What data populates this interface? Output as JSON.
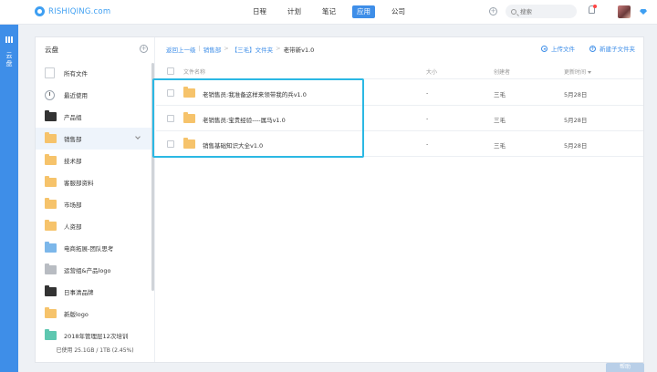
{
  "brand": {
    "name": "RISHIQING.com"
  },
  "nav": {
    "items": [
      "日程",
      "计划",
      "笔记",
      "应用",
      "公司"
    ],
    "active": "应用"
  },
  "header": {
    "search_placeholder": "搜索"
  },
  "leftbar": {
    "label": "云盘"
  },
  "sidebar": {
    "title": "云盘",
    "items": [
      {
        "label": "所有文件",
        "icon": "file-icon"
      },
      {
        "label": "最近使用",
        "icon": "clock-icon"
      },
      {
        "label": "产品组",
        "icon": "folder-icon"
      },
      {
        "label": "销售部",
        "icon": "folder-icon"
      },
      {
        "label": "技术部",
        "icon": "folder-icon"
      },
      {
        "label": "客服部资料",
        "icon": "folder-icon"
      },
      {
        "label": "市场部",
        "icon": "folder-icon"
      },
      {
        "label": "人资部",
        "icon": "folder-icon"
      },
      {
        "label": "电商拓展-团队思考",
        "icon": "folder-icon"
      },
      {
        "label": "运营组&产品logo",
        "icon": "folder-icon"
      },
      {
        "label": "日事清品牌",
        "icon": "folder-icon"
      },
      {
        "label": "新版logo",
        "icon": "folder-icon"
      },
      {
        "label": "2018年管理层12次培训",
        "icon": "folder-icon"
      }
    ],
    "usage": "已使用 25.1GB / 1TB (2.45%)"
  },
  "breadcrumb": {
    "back": "返回上一级",
    "items": [
      "销售部",
      "【三毛】文件夹",
      "老带新v1.0"
    ]
  },
  "toolbar": {
    "upload": "上传文件",
    "new_folder": "新建子文件夹"
  },
  "table": {
    "columns": {
      "name": "文件名称",
      "size": "大小",
      "creator": "创建者",
      "updated": "更新时间"
    },
    "rows": [
      {
        "name": "老销售员:我准备这样来领带我的兵v1.0",
        "size": "-",
        "creator": "三毛",
        "updated": "5月28日"
      },
      {
        "name": "老销售员:宝贵经验----属马v1.0",
        "size": "-",
        "creator": "三毛",
        "updated": "5月28日"
      },
      {
        "name": "销售基础知识大全v1.0",
        "size": "-",
        "creator": "三毛",
        "updated": "5月28日"
      }
    ]
  },
  "help": {
    "label": "帮助"
  }
}
